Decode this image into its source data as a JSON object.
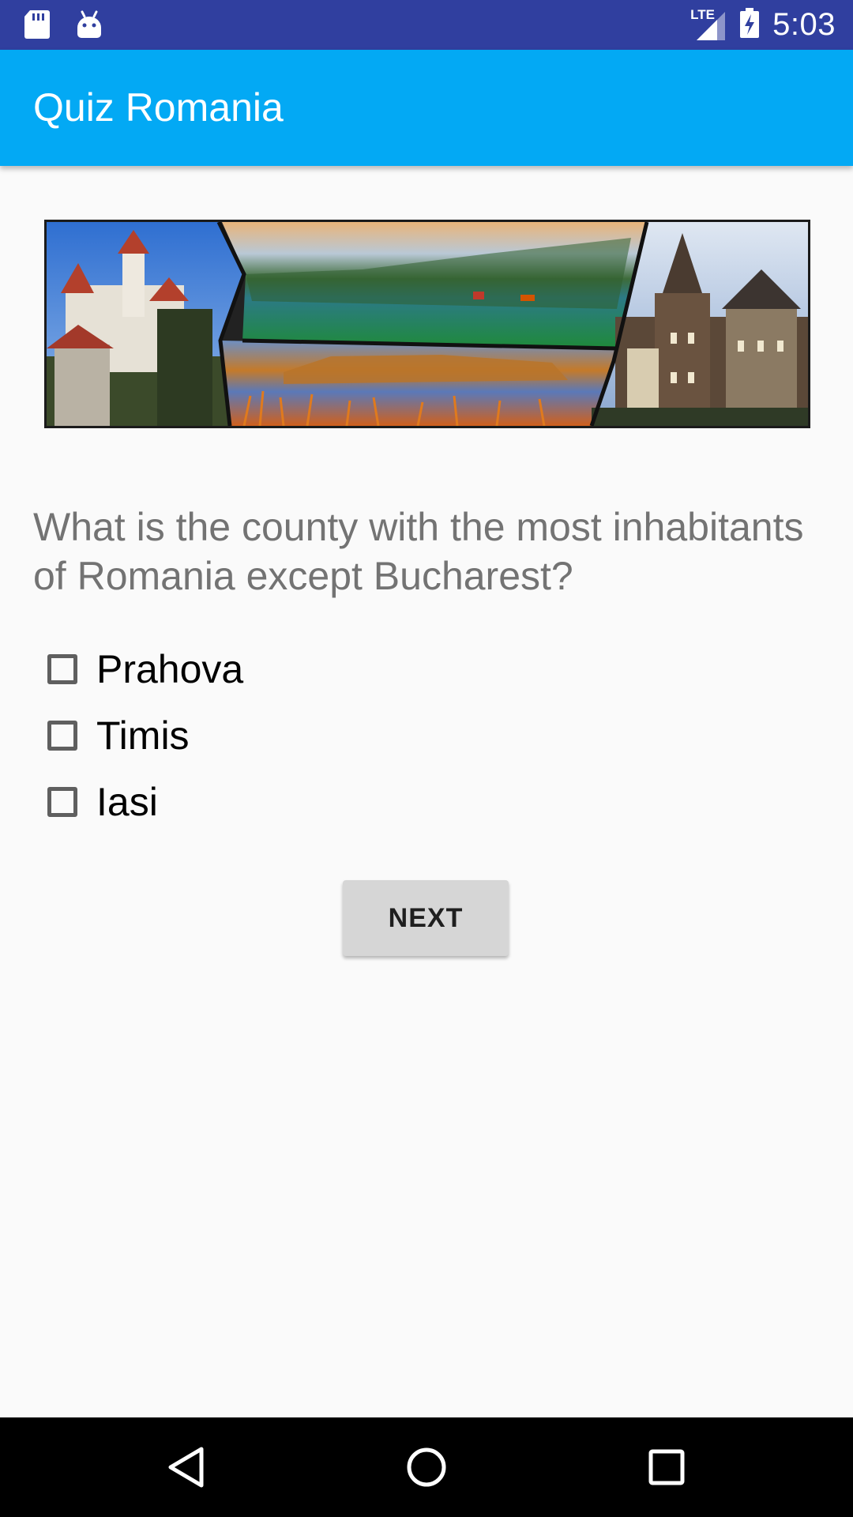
{
  "status_bar": {
    "time": "5:03",
    "network": "LTE",
    "left_icons": [
      "sd-card-icon",
      "android-icon"
    ],
    "right_icons": [
      "signal-icon",
      "battery-charging-icon"
    ]
  },
  "app_bar": {
    "title": "Quiz Romania"
  },
  "banner": {
    "icon": "romania-collage-image"
  },
  "question": {
    "text": "What is the county with the most inhabitants of Romania except Bucharest?"
  },
  "options": [
    {
      "label": "Prahova",
      "checked": false
    },
    {
      "label": "Timis",
      "checked": false
    },
    {
      "label": "Iasi",
      "checked": false
    }
  ],
  "next_button": {
    "label": "NEXT"
  },
  "nav_bar": {
    "icons": [
      "back-icon",
      "home-icon",
      "recents-icon"
    ]
  },
  "colors": {
    "status_bar": "#303f9f",
    "app_bar": "#03a9f4",
    "background": "#fafafa",
    "question_text": "#737373",
    "button": "#d6d6d6"
  }
}
